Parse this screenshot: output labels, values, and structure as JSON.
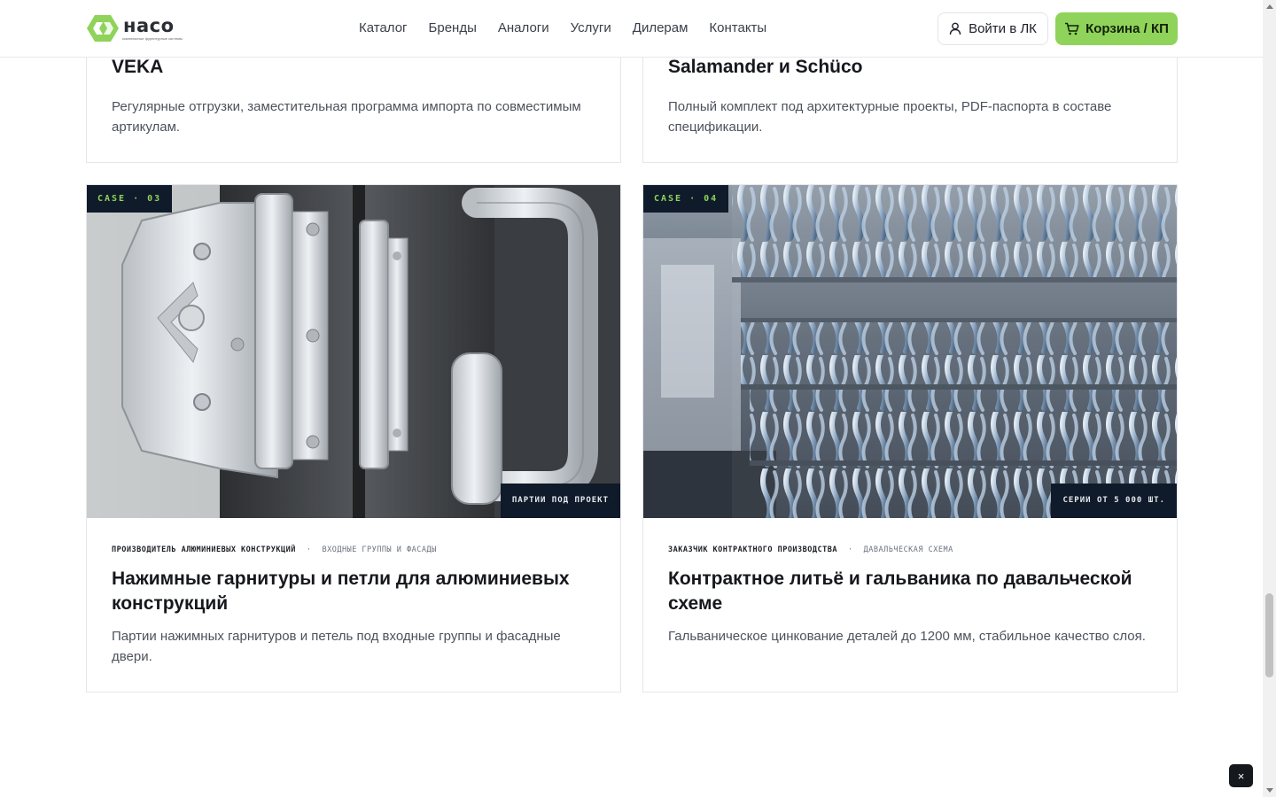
{
  "header": {
    "logo": {
      "word": "насо",
      "tagline": "комплексные фурнитурные системы",
      "brand_color": "#8fd35a"
    },
    "nav": [
      "Каталог",
      "Бренды",
      "Аналоги",
      "Услуги",
      "Дилерам",
      "Контакты"
    ],
    "login_label": "Войти в ЛК",
    "cart_label": "Корзина / КП"
  },
  "cards_top": [
    {
      "title": "VEKA",
      "desc": "Регулярные отгрузки, заместительная программа импорта по совместимым артикулам."
    },
    {
      "title": "Salamander и Schüco",
      "desc": "Полный комплект под архитектурные проекты, PDF-паспорта в составе спецификации."
    }
  ],
  "cases": [
    {
      "tag": "CASE · 03",
      "badge": "ПАРТИИ ПОД ПРОЕКТ",
      "client": "ПРОИЗВОДИТЕЛЬ АЛЮМИНИЕВЫХ КОНСТРУКЦИЙ",
      "segment": "ВХОДНЫЕ ГРУППЫ И ФАСАДЫ",
      "title": "Нажимные гарнитуры и петли для алюминиевых конструкций",
      "desc": "Партии нажимных гарнитуров и петель под входные группы и фасадные двери."
    },
    {
      "tag": "CASE · 04",
      "badge": "СЕРИИ ОТ 5 000 ШТ.",
      "client": "ЗАКАЗЧИК КОНТРАКТНОГО ПРОИЗВОДСТВА",
      "segment": "ДАВАЛЬЧЕСКАЯ СХЕМА",
      "title": "Контрактное литьё и гальваника по давальческой схеме",
      "desc": "Гальваническое цинкование деталей до 1200 мм, стабильное качество слоя."
    }
  ],
  "meta_separator": "·",
  "close_label": "×"
}
